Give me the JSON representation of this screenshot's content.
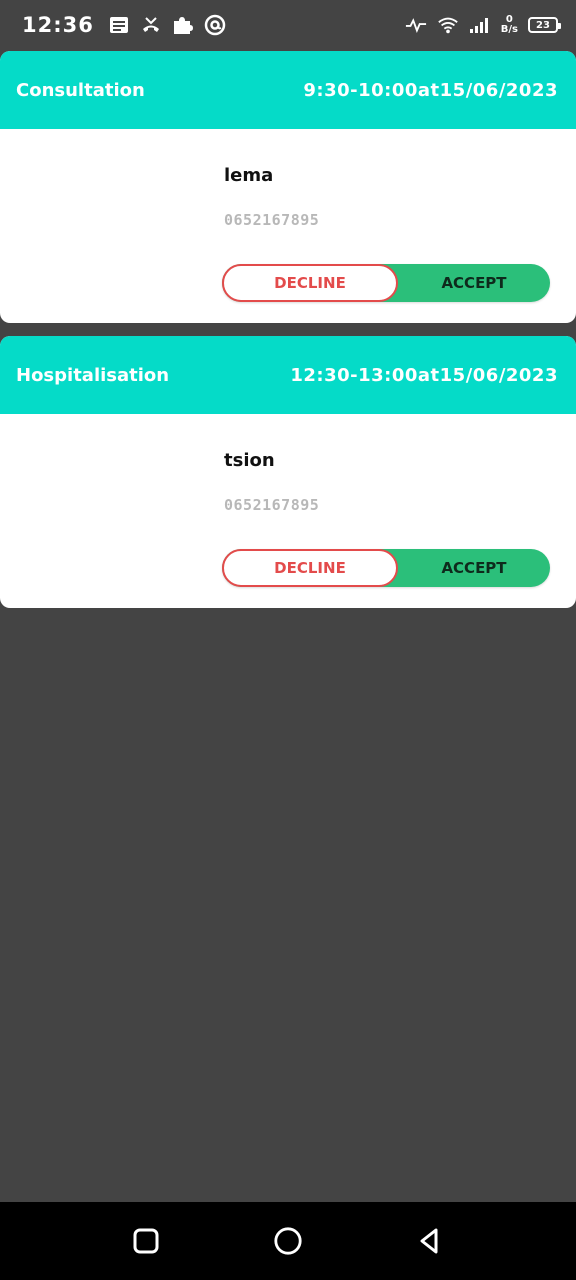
{
  "status_bar": {
    "time": "12:36",
    "net_speed_value": "0",
    "net_speed_unit": "B/s",
    "battery": "23",
    "left_icons": [
      "message-icon",
      "missed-call-icon",
      "puzzle-icon",
      "at-sign-icon"
    ],
    "right_icons": [
      "activity-icon",
      "wifi-icon",
      "signal-icon"
    ]
  },
  "appointments": [
    {
      "type": "Consultation",
      "time": "9:30-10:00at15/06/2023",
      "patient_name": "lema",
      "phone": "0652167895",
      "decline_label": "DECLINE",
      "accept_label": "ACCEPT"
    },
    {
      "type": "Hospitalisation",
      "time": "12:30-13:00at15/06/2023",
      "patient_name": "tsion",
      "phone": "0652167895",
      "decline_label": "DECLINE",
      "accept_label": "ACCEPT"
    }
  ],
  "navigation": {
    "buttons": [
      "recents-icon",
      "home-icon",
      "back-icon"
    ]
  },
  "colors": {
    "header": "#05dbc8",
    "accept": "#2bbf7a",
    "decline": "#e34b4b",
    "background": "#444444"
  }
}
